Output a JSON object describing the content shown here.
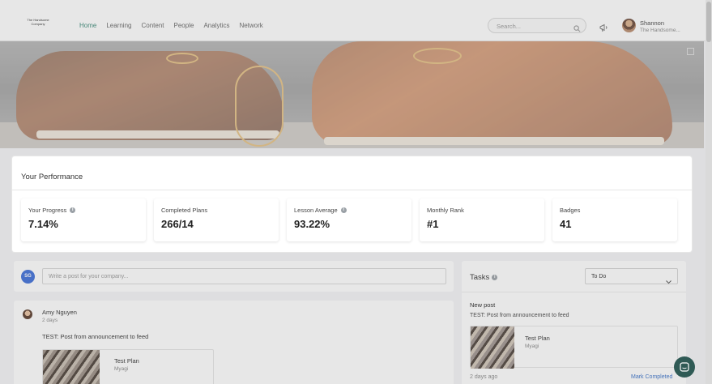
{
  "header": {
    "logo_text": "The Handsome Company",
    "nav": [
      {
        "label": "Home",
        "active": true
      },
      {
        "label": "Learning",
        "active": false
      },
      {
        "label": "Content",
        "active": false
      },
      {
        "label": "People",
        "active": false
      },
      {
        "label": "Analytics",
        "active": false
      },
      {
        "label": "Network",
        "active": false
      }
    ],
    "search_placeholder": "Search...",
    "user_name": "Shannon",
    "user_company": "The Handsome..."
  },
  "performance": {
    "title": "Your Performance",
    "stats": [
      {
        "label": "Your Progress",
        "value": "7.14%",
        "info": true
      },
      {
        "label": "Completed Plans",
        "value": "266/14",
        "info": false
      },
      {
        "label": "Lesson Average",
        "value": "93.22%",
        "info": true
      },
      {
        "label": "Monthly Rank",
        "value": "#1",
        "info": false
      },
      {
        "label": "Badges",
        "value": "41",
        "info": false
      }
    ]
  },
  "composer": {
    "initials": "SG",
    "placeholder": "Write a post for your company..."
  },
  "feed": {
    "author": "Amy Nguyen",
    "time": "2 days",
    "text": "TEST: Post from announcement to feed",
    "attachment_title": "Test Plan",
    "attachment_sub": "Myagi"
  },
  "tasks": {
    "title": "Tasks",
    "filter_value": "To Do",
    "item_heading": "New post",
    "item_text": "TEST: Post from announcement to feed",
    "attachment_title": "Test Plan",
    "attachment_sub": "Myagi",
    "time": "2 days ago",
    "mark_completed": "Mark Completed"
  },
  "colors": {
    "nav_active": "#3c8a78",
    "link": "#3c73c9",
    "avatar_bg": "#3d6ed8"
  }
}
